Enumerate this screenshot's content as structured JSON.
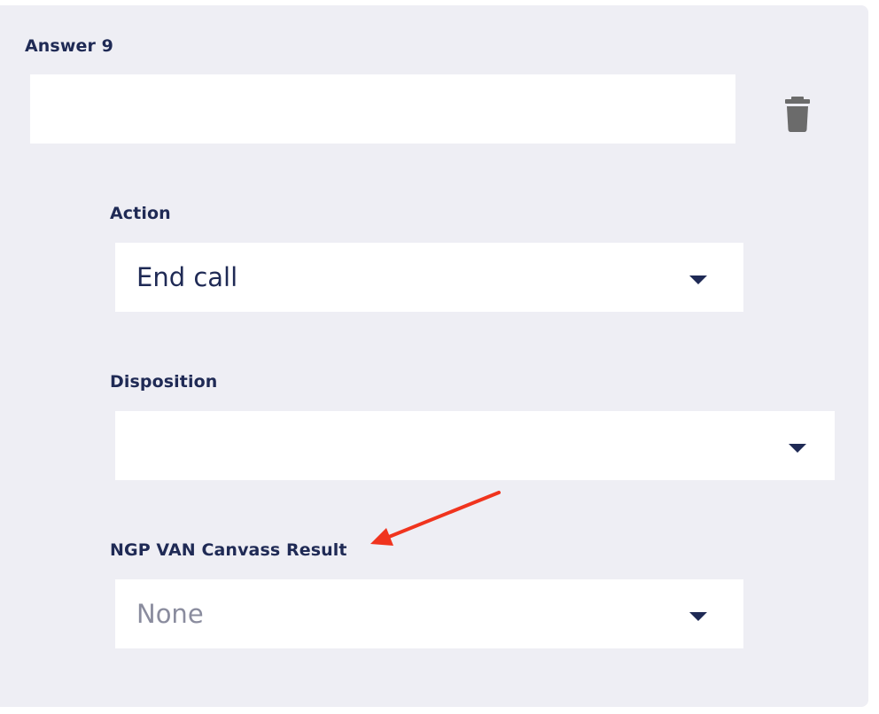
{
  "answer": {
    "title": "Answer 9",
    "text_value": ""
  },
  "action": {
    "label": "Action",
    "selected": "End call"
  },
  "disposition": {
    "label": "Disposition",
    "selected": ""
  },
  "canvass_result": {
    "label": "NGP VAN Canvass Result",
    "selected": "None"
  },
  "icons": {
    "delete": "trash-icon",
    "dropdown": "chevron-down-icon",
    "annotation": "arrow-icon"
  },
  "colors": {
    "panel_bg": "#eeeef4",
    "label_text": "#1f2a55",
    "placeholder_text": "#8a8c9e",
    "trash": "#6b6b6b",
    "annotation_arrow": "#f0341e"
  }
}
